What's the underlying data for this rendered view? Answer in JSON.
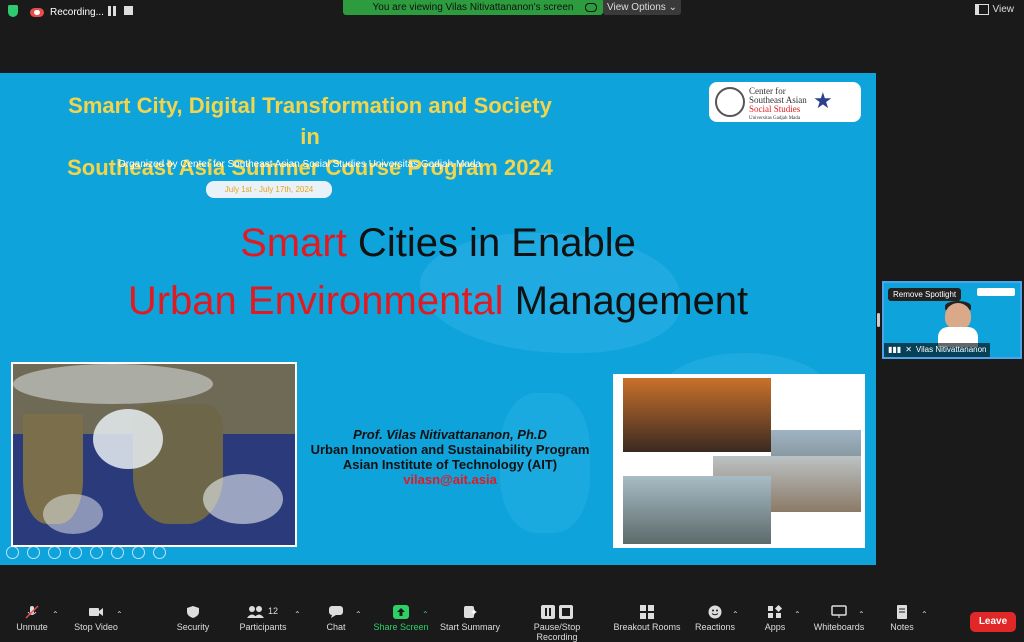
{
  "topbar": {
    "recording_label": "Recording...",
    "viewing_banner": "You are viewing Vilas Nitivattananon's screen",
    "view_options": "View Options",
    "view_label": "View"
  },
  "slide": {
    "title_line1": "Smart City, Digital Transformation and Society in",
    "title_line2": "Southeast Asia Summer Course Program 2024",
    "organizer": "Organized by Center for Southeast Asian Social Studies Universitas Gadjah Mada",
    "dates": "July 1st - July 17th, 2024",
    "logo_text_1": "Center for",
    "logo_text_2": "Southeast Asian",
    "logo_text_3": "Social Studies",
    "logo_text_4": "Universitas Gadjah Mada",
    "heading1_red": "Smart",
    "heading1_black": " Cities in Enable",
    "heading2_red": "Urban Environmental",
    "heading2_black": " Management",
    "presenter_name": "Prof. Vilas Nitivattananon, Ph.D",
    "program": "Urban Innovation and Sustainability Program",
    "institute": "Asian Institute of Technology (AIT)",
    "email": "vilasn@ait.asia"
  },
  "participant_thumb": {
    "remove_spotlight": "Remove Spotlight",
    "name": "Vilas Nitivattananon"
  },
  "toolbar": {
    "unmute": "Unmute",
    "stop_video": "Stop Video",
    "security": "Security",
    "participants": "Participants",
    "participant_count": "12",
    "chat": "Chat",
    "share_screen": "Share Screen",
    "start_summary": "Start Summary",
    "pause_stop_recording": "Pause/Stop Recording",
    "breakout_rooms": "Breakout Rooms",
    "reactions": "Reactions",
    "apps": "Apps",
    "whiteboards": "Whiteboards",
    "notes": "Notes",
    "leave": "Leave"
  },
  "colors": {
    "slide_bg": "#0fa3db",
    "title_yellow": "#f3d54b",
    "accent_red": "#e11a22",
    "banner_green": "#2d9c3e",
    "leave_red": "#e02828"
  }
}
